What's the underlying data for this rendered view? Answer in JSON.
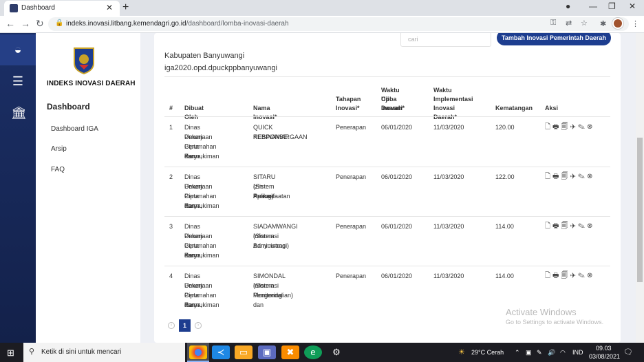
{
  "browser": {
    "tab_title": "Dashboard",
    "url_host": "indeks.inovasi.litbang.kemendagri.go.id",
    "url_path": "/dashboard/lomba-inovasi-daerah"
  },
  "sidebar": {
    "brand": "INDEKS INOVASI DAERAH",
    "title": "Dashboard",
    "items": [
      {
        "label": "Dashboard IGA"
      },
      {
        "label": "Arsip"
      },
      {
        "label": "FAQ"
      }
    ]
  },
  "main": {
    "search_placeholder": "cari",
    "add_button": "Tambah Inovasi Pemerintah Daerah",
    "region": "Kabupaten Banyuwangi",
    "account": "iga2020.opd.dpuckppbanyuwangi",
    "columns": [
      {
        "lines": [
          "#"
        ]
      },
      {
        "lines": [
          "Dibuat Oleh"
        ]
      },
      {
        "lines": [
          "Nama Inovasi*"
        ]
      },
      {
        "lines": [
          "Tahapan",
          "Inovasi*"
        ]
      },
      {
        "lines": [
          "Waktu Uji",
          "Coba Inovasi",
          "Daerah*"
        ]
      },
      {
        "lines": [
          "Waktu",
          "Implementasi",
          "Inovasi Daerah*"
        ]
      },
      {
        "lines": [
          "Kematangan"
        ]
      },
      {
        "lines": [
          "Aksi"
        ]
      }
    ],
    "rows": [
      {
        "no": "1",
        "by": [
          "Dinas Pekerjaan",
          "Umum Cipta Karya,",
          "Perumahan dan",
          "Permukiman"
        ],
        "name": [
          "QUICK RESPONSE",
          "KEBINAMARGAAN"
        ],
        "stage": "Penerapan",
        "trial": "06/01/2020",
        "impl": "11/03/2020",
        "maturity": "120.00",
        "actions": "🗋🖶🗐✈✎⊗"
      },
      {
        "no": "2",
        "by": [
          "Dinas Pekerjaan",
          "Umum Cipta Karya,",
          "Perumahan dan",
          "Permukiman"
        ],
        "name": [
          "SITARU (Sistem Aplikasi",
          "Izin Pemanfaatan",
          "Ruang)"
        ],
        "stage": "Penerapan",
        "trial": "06/01/2020",
        "impl": "11/03/2020",
        "maturity": "122.00",
        "actions": "🗋🖶🗐✈✎⊗"
      },
      {
        "no": "3",
        "by": [
          "Dinas Pekerjaan",
          "Umum Cipta Karya,",
          "Perumahan dan",
          "Permukiman"
        ],
        "name": [
          "SIADAMWANGI (Sistem",
          "Informasi Administrasi",
          "Banyuwangi)"
        ],
        "stage": "Penerapan",
        "trial": "06/01/2020",
        "impl": "11/03/2020",
        "maturity": "114.00",
        "actions": "🗋🖶🗐✈✎⊗"
      },
      {
        "no": "4",
        "by": [
          "Dinas Pekerjaan",
          "Umum Cipta Karya,",
          "Perumahan dan",
          "Permukiman"
        ],
        "name": [
          "SIMONDAL (Sistem",
          "Informasi Monitoring dan",
          "Pengendalian)"
        ],
        "stage": "Penerapan",
        "trial": "06/01/2020",
        "impl": "11/03/2020",
        "maturity": "114.00",
        "actions": "🗋🖶🗐✈✎⊗"
      }
    ],
    "current_page": "1"
  },
  "watermark": {
    "line1": "Activate Windows",
    "line2": "Go to Settings to activate Windows."
  },
  "taskbar": {
    "search_placeholder": "Ketik di sini untuk mencari",
    "weather": "29°C  Cerah",
    "lang": "IND",
    "time": "09.03",
    "date": "03/08/2021"
  }
}
